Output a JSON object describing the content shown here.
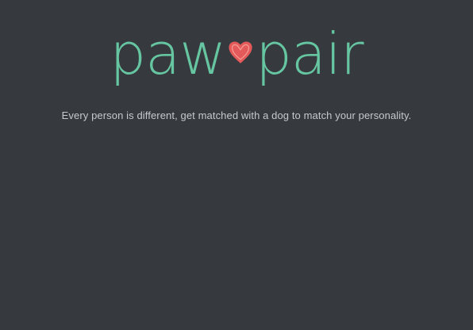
{
  "brand": {
    "word_left": "paw",
    "word_right": "pair",
    "logo_color": "#66c6a2",
    "heart_color": "#e45a5a",
    "heart_icon": "heart-icon"
  },
  "tagline": "Every person is different, get matched with a dog to match your personality.",
  "theme": {
    "background": "#363a3e",
    "text": "#c6c9cb"
  }
}
